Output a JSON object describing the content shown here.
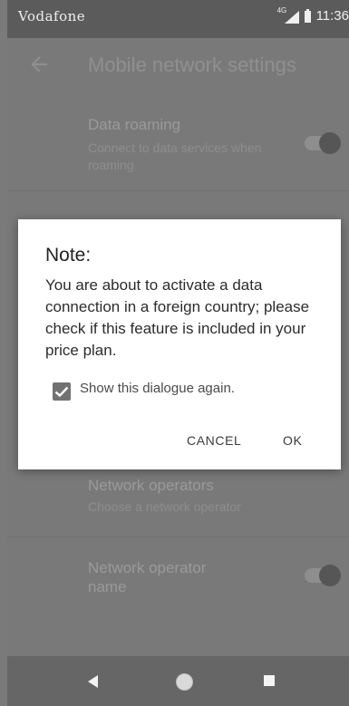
{
  "status_bar": {
    "carrier": "Vodafone",
    "network_type": "4G",
    "time": "11:36"
  },
  "header": {
    "title": "Mobile network settings"
  },
  "settings": {
    "data_roaming": {
      "title": "Data roaming",
      "subtitle": "Connect to data services when roaming",
      "enabled": true
    },
    "network_operators": {
      "title": "Network operators",
      "subtitle": "Choose a network operator"
    },
    "network_operator_name": {
      "title": "Network operator name",
      "enabled": true
    }
  },
  "dialog": {
    "title": "Note:",
    "message": "You are about to activate a data connection in a foreign country; please check if this feature is included in your price plan.",
    "checkbox_label": "Show this dialogue again.",
    "checkbox_checked": true,
    "cancel_label": "CANCEL",
    "ok_label": "OK"
  },
  "nav_bar": {
    "icons": [
      "back-icon",
      "home-icon",
      "recents-icon"
    ]
  },
  "colors": {
    "scrim": "#7a7a7a",
    "dialog_bg": "#ffffff",
    "checkbox": "#727272"
  }
}
